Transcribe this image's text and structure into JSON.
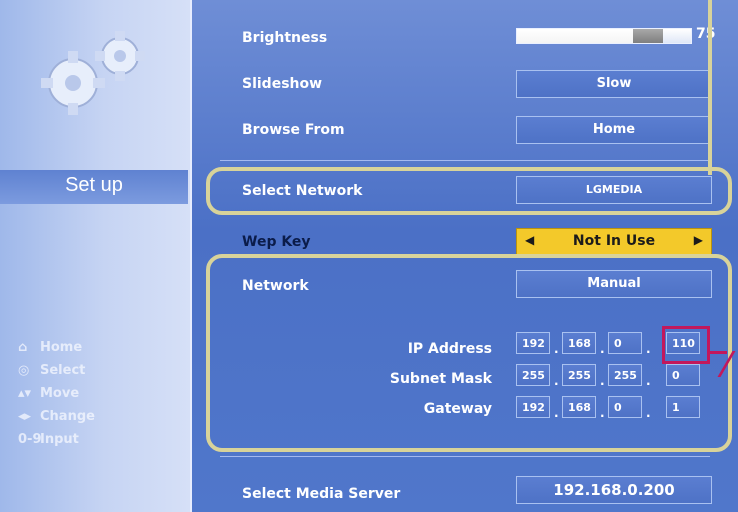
{
  "sidebar": {
    "title": "Set up",
    "legend": [
      {
        "icon": "home-icon",
        "glyph": "⌂",
        "label": "Home"
      },
      {
        "icon": "select-icon",
        "glyph": "◎",
        "label": "Select"
      },
      {
        "icon": "move-icon",
        "glyph": "▴▾",
        "label": "Move"
      },
      {
        "icon": "change-icon",
        "glyph": "◂▸",
        "label": "Change"
      },
      {
        "icon": "input-icon",
        "glyph": "0-9",
        "label": "Input"
      }
    ]
  },
  "settings": {
    "brightness": {
      "label": "Brightness",
      "value": "75",
      "fill_percent": 75
    },
    "slideshow": {
      "label": "Slideshow",
      "value": "Slow"
    },
    "browse_from": {
      "label": "Browse From",
      "value": "Home"
    },
    "select_network": {
      "label": "Select Network",
      "value": "LGMEDIA"
    },
    "wep_key": {
      "label": "Wep Key",
      "value": "Not In Use",
      "left_arrow": "◀",
      "right_arrow": "▶"
    },
    "network": {
      "label": "Network",
      "value": "Manual"
    },
    "ip_address": {
      "label": "IP Address",
      "octets": [
        "192",
        "168",
        "0",
        "110"
      ]
    },
    "subnet_mask": {
      "label": "Subnet Mask",
      "octets": [
        "255",
        "255",
        "255",
        "0"
      ]
    },
    "gateway": {
      "label": "Gateway",
      "octets": [
        "192",
        "168",
        "0",
        "1"
      ]
    },
    "media_server": {
      "label": "Select Media Server",
      "value": "192.168.0.200"
    }
  },
  "colors": {
    "highlight": "#d8d39a",
    "callout": "#c2185b",
    "wep_bg": "#f3c92a"
  }
}
